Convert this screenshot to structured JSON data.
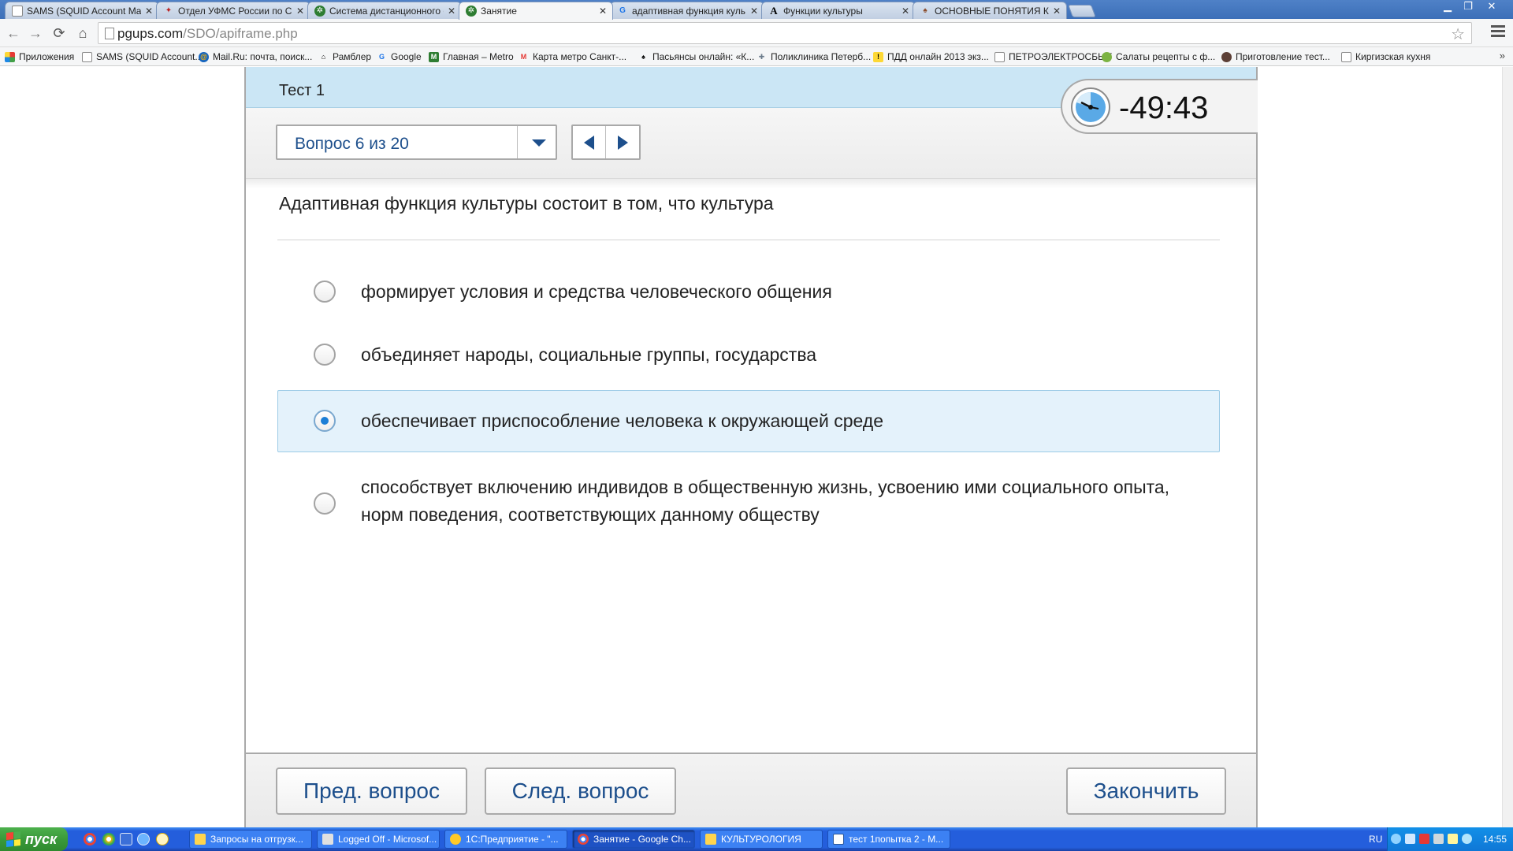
{
  "browser": {
    "tabs": [
      {
        "title": "SAMS (SQUID Account Mana",
        "active": false,
        "icon": "page-icon"
      },
      {
        "title": "Отдел УФМС России по Сан",
        "active": false,
        "icon": "emblem-icon"
      },
      {
        "title": "Система дистанционного о",
        "active": false,
        "icon": "green-logo-icon"
      },
      {
        "title": "Занятие",
        "active": true,
        "icon": "green-logo-icon"
      },
      {
        "title": "адаптивная функция куль",
        "active": false,
        "icon": "google-icon"
      },
      {
        "title": "Функции культуры",
        "active": false,
        "icon": "letter-a-icon"
      },
      {
        "title": "ОСНОВНЫЕ ПОНЯТИЯ КУЛЬ",
        "active": false,
        "icon": "site-icon"
      }
    ],
    "url_host": "pgups.com",
    "url_path": "/SDO/apiframe.php",
    "bookmarks": [
      "Приложения",
      "SAMS (SQUID Account...",
      "Mail.Ru: почта, поиск...",
      "Рамблер",
      "Google",
      "Главная – Metro",
      "Карта метро Санкт-...",
      "Пасьянсы онлайн: «К...",
      "Поликлиника Петерб...",
      "ПДД онлайн 2013 экз...",
      "ПЕТРОЭЛЕКТРОСБЫТ",
      "Салаты рецепты с ф...",
      "Приготовление тест...",
      "Киргизская кухня"
    ],
    "bookmarks_more": "»"
  },
  "test": {
    "title": "Тест 1",
    "question_selector": "Вопрос 6 из 20",
    "timer": "-49:43",
    "question_text": "Адаптивная функция культуры состоит в  том, что культура",
    "options": [
      {
        "text": "формирует условия и средства человеческого общения",
        "selected": false
      },
      {
        "text": "объединяет народы, социальные группы, государства",
        "selected": false
      },
      {
        "text": "обеспечивает приспособление человека к окружающей среде",
        "selected": true
      },
      {
        "text": "способствует  включению индивидов в общественную жизнь, усвоению ими социального опыта, норм поведения, соответствующих данному обществу",
        "selected": false
      }
    ],
    "buttons": {
      "prev": "Пред. вопрос",
      "next": "След. вопрос",
      "finish": "Закончить"
    }
  },
  "taskbar": {
    "start_label": "пуск",
    "tasks": [
      {
        "title": "Запросы на отгрузк...",
        "active": false
      },
      {
        "title": "Logged Off - Microsof...",
        "active": false
      },
      {
        "title": "1С:Предприятие - \"...",
        "active": false
      },
      {
        "title": "Занятие - Google Ch...",
        "active": true
      },
      {
        "title": "КУЛЬТУРОЛОГИЯ",
        "active": false
      },
      {
        "title": "тест 1попытка 2 - M...",
        "active": false
      }
    ],
    "lang": "RU",
    "clock": "14:55"
  },
  "colors": {
    "accent_blue": "#1d4f8c",
    "header_bg": "#cbe6f5",
    "selected_option_bg": "#e4f2fb",
    "radio_dot": "#1c7ed6"
  }
}
